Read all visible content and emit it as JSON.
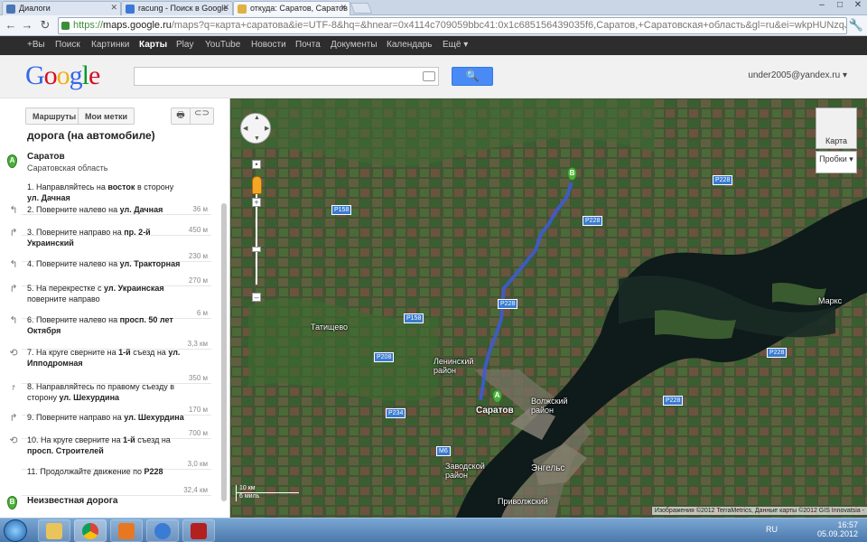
{
  "browser": {
    "tabs": [
      {
        "label": "Диалоги",
        "active": false
      },
      {
        "label": "racung - Поиск в Google",
        "active": false
      },
      {
        "label": "откуда: Саратов, Саратов",
        "active": true
      }
    ],
    "url_scheme": "https://",
    "url_host": "maps.google.ru",
    "url_path": "/maps?q=карта+саратова&ie=UTF-8&hq=&hnear=0x4114c709059bbc41:0x1c685156439035f6,Саратов,+Саратовская+область&gl=ru&ei=wkpHUNzqJaTI4QSIloDw"
  },
  "gbar": {
    "items": [
      "+Вы",
      "Поиск",
      "Картинки",
      "Карты",
      "Play",
      "YouTube",
      "Новости",
      "Почта",
      "Документы",
      "Календарь",
      "Ещё ▾"
    ],
    "selected": "Карты"
  },
  "header": {
    "logo": "Google",
    "search_value": "",
    "account": "under2005@yandex.ru ▾"
  },
  "sidebar": {
    "routes_button": "Маршруты",
    "mylabels_button": "Мои метки",
    "print_glyph": "🖶",
    "link_glyph": "⊂⊃",
    "route_title": "дорога (на автомобиле)",
    "origin": {
      "marker": "A",
      "name": "Саратов",
      "region": "Саратовская область"
    },
    "steps": [
      {
        "num": "1.",
        "text_pre": "Направляйтесь на ",
        "b1": "восток",
        "text_mid": " в сторону ",
        "b2": "ул. Дачная",
        "dist": "36 м",
        "icon": "none"
      },
      {
        "num": "2.",
        "text_pre": "Поверните налево на ",
        "b1": "ул. Дачная",
        "text_mid": "",
        "b2": "",
        "dist": "450 м",
        "icon": "turn-left"
      },
      {
        "num": "3.",
        "text_pre": "Поверните направо на ",
        "b1": "пр. 2-й Украинский",
        "text_mid": "",
        "b2": "",
        "dist": "230 м",
        "icon": "turn-right"
      },
      {
        "num": "4.",
        "text_pre": "Поверните налево на ",
        "b1": "ул. Тракторная",
        "text_mid": "",
        "b2": "",
        "dist": "270 м",
        "icon": "turn-left"
      },
      {
        "num": "5.",
        "text_pre": "На перекрестке с ",
        "b1": "ул. Украинская",
        "text_mid": " поверните направо",
        "b2": "",
        "dist": "6 м",
        "icon": "turn-right"
      },
      {
        "num": "6.",
        "text_pre": "Поверните налево на ",
        "b1": "просп. 50 лет Октября",
        "text_mid": "",
        "b2": "",
        "dist": "3,3 км",
        "icon": "turn-left"
      },
      {
        "num": "7.",
        "text_pre": "На круге сверните на ",
        "b1": "1-й",
        "text_mid": " съезд на ",
        "b2": "ул. Ипподромная",
        "dist": "350 м",
        "icon": "roundabout"
      },
      {
        "num": "8.",
        "text_pre": "Направляйтесь по правому съезду в сторону ",
        "b1": "ул. Шехурдина",
        "text_mid": "",
        "b2": "",
        "dist": "170 м",
        "icon": "keep-right"
      },
      {
        "num": "9.",
        "text_pre": "Поверните направо на ",
        "b1": "ул. Шехурдина",
        "text_mid": "",
        "b2": "",
        "dist": "700 м",
        "icon": "turn-right"
      },
      {
        "num": "10.",
        "text_pre": "На круге сверните на ",
        "b1": "1-й",
        "text_mid": " съезд на ",
        "b2": "просп. Строителей",
        "dist": "3,0 км",
        "icon": "roundabout"
      },
      {
        "num": "11.",
        "text_pre": "Продолжайте движение по ",
        "b1": "",
        "text_mid": "",
        "b2": "Р228",
        "dist": "32,4 км",
        "icon": "none"
      }
    ],
    "destination": {
      "marker": "B",
      "name": "Неизвестная дорога"
    }
  },
  "map": {
    "labels": [
      "Саратов",
      "Волжский район",
      "Ленинский район",
      "Заводской район",
      "Энгельс",
      "Приволжский",
      "Татищево",
      "Маркс"
    ],
    "road_tags": [
      "Р228",
      "Р158",
      "Р208",
      "Р234",
      "M6"
    ],
    "marker_a": "A",
    "marker_b": "B",
    "maptype_label": "Карта",
    "traffic_label": "Пробки",
    "scale_km": "10 км",
    "scale_mi": "6 миль",
    "copyright": "Изображения ©2012 TerraMetrics, Данные карты ©2012 GIS Innovatsia -"
  },
  "taskbar": {
    "lang": "RU",
    "time": "16:57",
    "date": "05.09.2012"
  },
  "colors": {
    "route": "#3d5bd8",
    "marker": "#4caf3a",
    "search_button": "#4a8af4"
  }
}
